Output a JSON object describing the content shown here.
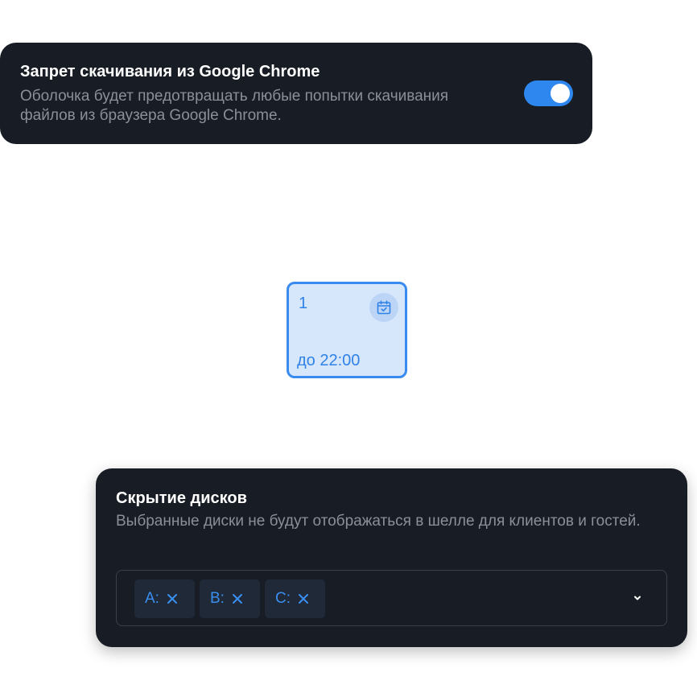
{
  "download_ban": {
    "title": "Запрет скачивания из Google Chrome",
    "description": "Оболочка будет предотвращать любые попытки скачивания файлов из браузера Google Chrome.",
    "toggle_enabled": true
  },
  "day_tile": {
    "day": "1",
    "time": "до 22:00",
    "icon": "calendar-check-icon"
  },
  "hide_drives": {
    "title": "Скрытие дисков",
    "description": "Выбранные диски не будут отображаться в шелле для клиентов и гостей.",
    "selected": [
      {
        "label": "A:",
        "remove_icon": "close-icon"
      },
      {
        "label": "B:",
        "remove_icon": "close-icon"
      },
      {
        "label": "C:",
        "remove_icon": "close-icon"
      }
    ],
    "dropdown_icon": "chevron-down-icon"
  },
  "colors": {
    "card_bg": "#181d25",
    "accent": "#2d87ee",
    "tile_bg": "#d6e6fb",
    "chip_bg": "#1f2937",
    "muted_text": "#8a8f98"
  }
}
